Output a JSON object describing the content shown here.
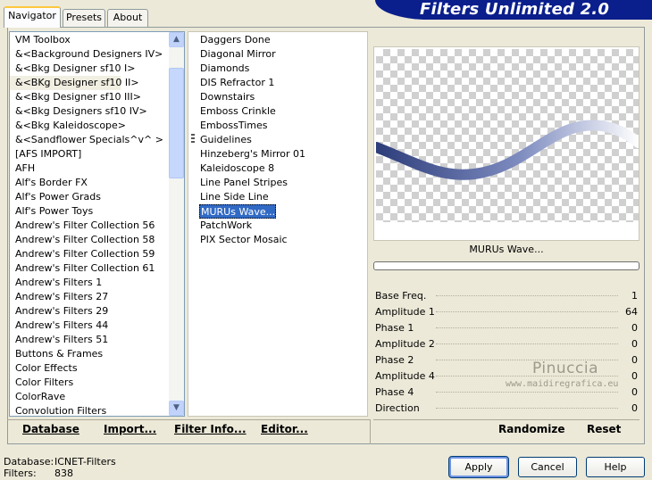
{
  "app": {
    "title": "Filters Unlimited 2.0"
  },
  "tabs": [
    {
      "label": "Navigator"
    },
    {
      "label": "Presets"
    },
    {
      "label": "About"
    }
  ],
  "categories": [
    "VM Toolbox",
    "&<Background Designers IV>",
    "&<Bkg Designer sf10 I>",
    "&<BKg Designer sf10 II>",
    "&<Bkg Designer sf10 III>",
    "&<Bkg Designers sf10 IV>",
    "&<Bkg Kaleidoscope>",
    "&<Sandflower Specials^v^ >",
    "[AFS IMPORT]",
    "AFH",
    "Alf's Border FX",
    "Alf's Power Grads",
    "Alf's Power Toys",
    "Andrew's Filter Collection 56",
    "Andrew's Filter Collection 58",
    "Andrew's Filter Collection 59",
    "Andrew's Filter Collection 61",
    "Andrew's Filters 1",
    "Andrew's Filters 27",
    "Andrew's Filters 29",
    "Andrew's Filters 44",
    "Andrew's Filters 51",
    "Buttons & Frames",
    "Color Effects",
    "Color Filters",
    "ColorRave",
    "Convolution Filters"
  ],
  "filters": [
    "Daggers Done",
    "Diagonal Mirror",
    "Diamonds",
    "DIS Refractor 1",
    "Downstairs",
    "Emboss Crinkle",
    "EmbossTimes",
    "Guidelines",
    "Hinzeberg's Mirror 01",
    "Kaleidoscope 8",
    "Line Panel Stripes",
    "Line Side Line",
    "MURUs Wave...",
    "PatchWork",
    "PIX Sector Mosaic"
  ],
  "selected_filter": "MURUs Wave...",
  "params": [
    {
      "label": "Base Freq.",
      "value": "1"
    },
    {
      "label": "Amplitude 1",
      "value": "64"
    },
    {
      "label": "Phase 1",
      "value": "0"
    },
    {
      "label": "Amplitude 2",
      "value": "0"
    },
    {
      "label": "Phase 2",
      "value": "0"
    },
    {
      "label": "Amplitude 4",
      "value": "0"
    },
    {
      "label": "Phase 4",
      "value": "0"
    },
    {
      "label": "Direction",
      "value": "0"
    }
  ],
  "toolbar": {
    "database": "Database",
    "import": "Import...",
    "filter_info": "Filter Info...",
    "editor": "Editor...",
    "randomize": "Randomize",
    "reset": "Reset"
  },
  "watermark": {
    "name": "Pinuccia",
    "url": "www.maidiregrafica.eu"
  },
  "status": {
    "database_label": "Database:",
    "database_value": "ICNET-Filters",
    "filters_label": "Filters:",
    "filters_value": "838"
  },
  "buttons": {
    "apply": "Apply",
    "cancel": "Cancel",
    "help": "Help"
  },
  "colors": {
    "banner": "#0a1e8c",
    "selection": "#316ac5"
  }
}
